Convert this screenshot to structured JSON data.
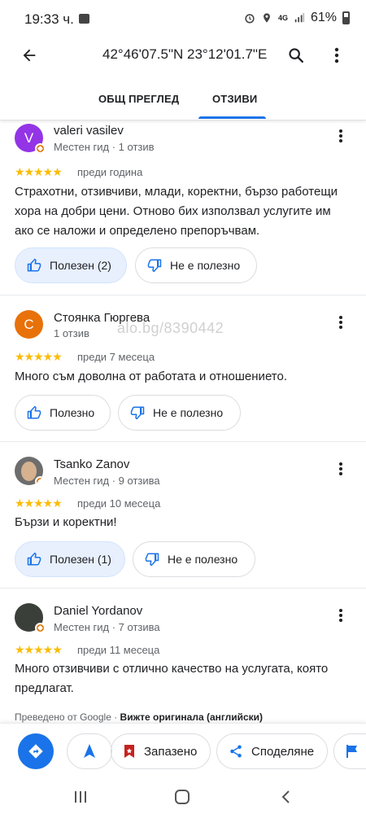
{
  "status_bar": {
    "time": "19:33 ч.",
    "network": "4G",
    "battery": "61%"
  },
  "app_bar": {
    "title": "42°46'07.5\"N 23°12'01.7\"E"
  },
  "tabs": [
    {
      "label": "ОБЩ ПРЕГЛЕД",
      "active": false
    },
    {
      "label": "ОТЗИВИ",
      "active": true
    }
  ],
  "accent_color": "#1a73e8",
  "watermark": "alo.bg/8390442",
  "reviews": [
    {
      "author": "valeri vasilev",
      "avatar_letter": "V",
      "avatar_color": "#9334e6",
      "meta": "Местен гид · 1 отзив",
      "stars": "★★★★★",
      "date": "преди година",
      "text": "Страхотни, отзивчиви, млади, коректни, бързо работещи хора на добри цени. Отново бих използвал услугите им ако се наложи и определено препоръчвам.",
      "helpful_label": "Полезен (2)",
      "not_helpful_label": "Не е полезно"
    },
    {
      "author": "Стоянка Гюргева",
      "avatar_letter": "С",
      "avatar_color": "#e8710a",
      "meta": "1 отзив",
      "stars": "★★★★★",
      "date": "преди 7 месеца",
      "text": "Много съм доволна от работата и отношението.",
      "helpful_label": "Полезно",
      "not_helpful_label": "Не е полезно"
    },
    {
      "author": "Tsanko Zanov",
      "meta": "Местен гид · 9 отзива",
      "stars": "★★★★★",
      "date": "преди 10 месеца",
      "text": "Бързи и коректни!",
      "helpful_label": "Полезен (1)",
      "not_helpful_label": "Не е полезно"
    },
    {
      "author": "Daniel Yordanov",
      "meta": "Местен гид · 7 отзива",
      "stars": "★★★★★",
      "date": "преди 11 месеца",
      "text": "Много отзивчиви с отлично качество на услугата, която предлагат.",
      "translated_prefix": "Преведено от Google · ",
      "translated_link": "Вижте оригинала (английски)"
    }
  ],
  "action_bar": {
    "save_label": "Запазено",
    "share_label": "Споделяне"
  }
}
